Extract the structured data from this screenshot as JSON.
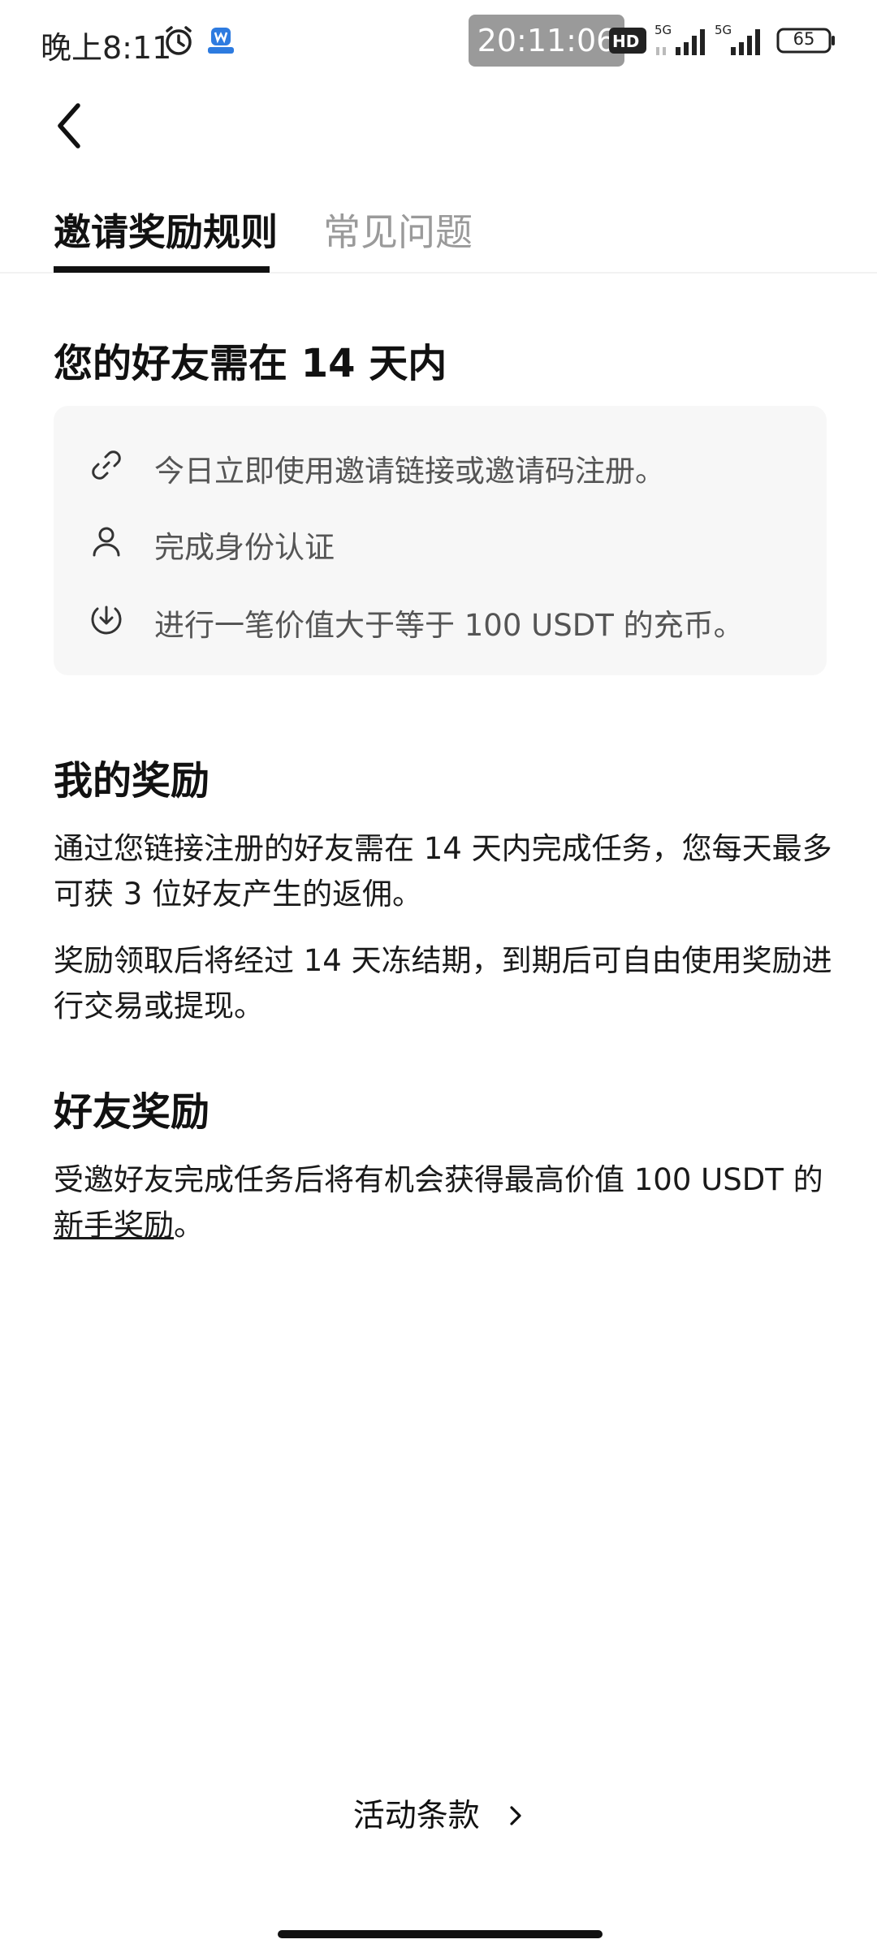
{
  "status_bar": {
    "time": "晚上8:11",
    "clock_pill": "20:11:06",
    "network_1": "5G",
    "network_2": "5G",
    "battery": "65"
  },
  "tabs": [
    {
      "label": "邀请奖励规则",
      "active": true
    },
    {
      "label": "常见问题",
      "active": false
    }
  ],
  "requirements": {
    "title": "您的好友需在 14 天内",
    "items": [
      {
        "icon": "link-icon",
        "text": "今日立即使用邀请链接或邀请码注册。"
      },
      {
        "icon": "user-icon",
        "text": "完成身份认证"
      },
      {
        "icon": "deposit-icon",
        "text": "进行一笔价值大于等于 100 USDT 的充币。"
      }
    ]
  },
  "my_rewards": {
    "title": "我的奖励",
    "p1": "通过您链接注册的好友需在 14 天内完成任务，您每天最多可获 3 位好友产生的返佣。",
    "p2": "奖励领取后将经过 14 天冻结期，到期后可自由使用奖励进行交易或提现。"
  },
  "friend_rewards": {
    "title": "好友奖励",
    "p_prefix": "受邀好友完成任务后将有机会获得最高价值 100 USDT 的",
    "p_link": "新手奖励",
    "p_suffix": "。"
  },
  "terms_label": "活动条款"
}
